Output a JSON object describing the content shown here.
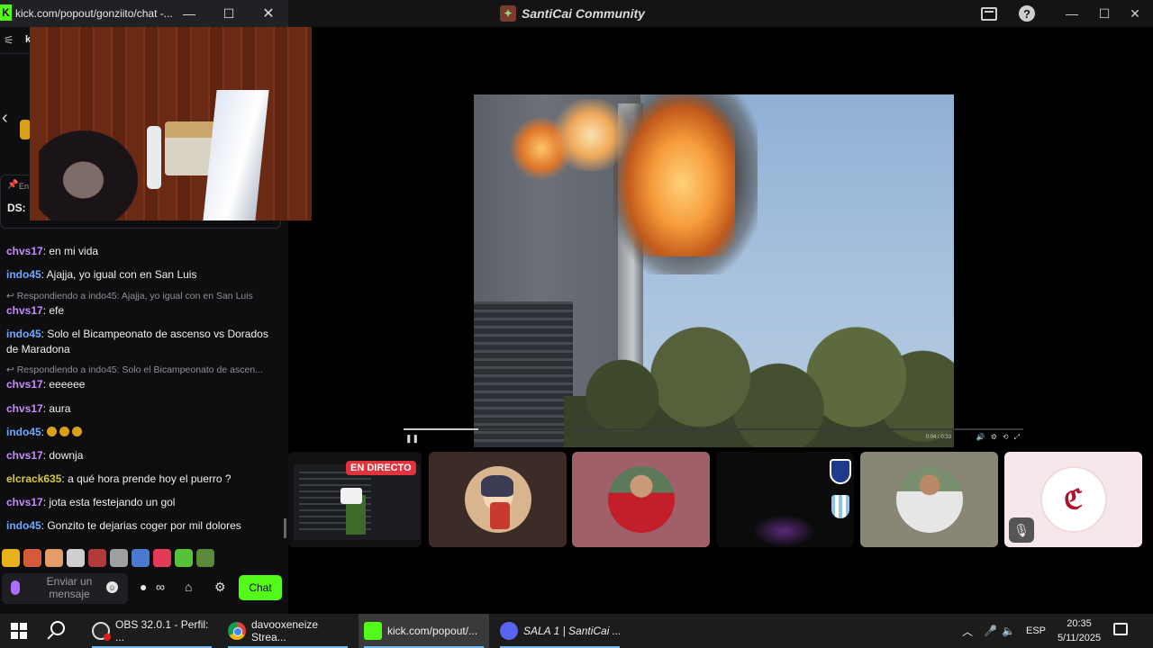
{
  "main_window": {
    "title": "SantiCai Community",
    "video": {
      "time": "0:04 / 0:33",
      "progress": 0.12
    },
    "tiles": {
      "live_badge": "EN DIRECTO",
      "logo_tile_text": "ℭ"
    }
  },
  "chat_window": {
    "url": "kick.com/popout/gonziito/chat -...",
    "header_k": "k",
    "pinned_label": "En",
    "pinned_ds": "DS:",
    "messages": [
      {
        "user": "chvs17",
        "text": ": en mi vida"
      },
      {
        "user": "indo45",
        "text": ": Ajajja, yo igual con en San Luis"
      },
      {
        "reply": "Respondiendo a indo45: Ajajja, yo igual con en San Luis"
      },
      {
        "user": "chvs17",
        "text": ": efe"
      },
      {
        "user": "indo45",
        "text": ": Solo el Bicampeonato de ascenso vs Dorados de Maradona"
      },
      {
        "reply": "Respondiendo a indo45: Solo el Bicampeonato de ascen..."
      },
      {
        "user": "chvs17",
        "text": ": eeeeee"
      },
      {
        "user": "chvs17",
        "text": ": aura"
      },
      {
        "user": "indo45",
        "text": ":"
      },
      {
        "user": "chvs17",
        "text": ": downja"
      },
      {
        "user": "elcrack635",
        "text": ": a qué hora prende hoy el puerro ?"
      },
      {
        "user": "chvs17",
        "text": ": jota esta festejando un gol"
      },
      {
        "user": "indo45",
        "text": ": Gonzito te dejarias coger por mil dolores"
      }
    ],
    "input_placeholder": "Enviar un mensaje",
    "chat_button": "Chat",
    "emote_colors": [
      "#e8b21a",
      "#d45a3a",
      "#e59b6a",
      "#cfcfcf",
      "#b33a3a",
      "#a0a0a0",
      "#4a7ad0",
      "#e33a5a",
      "#55c23a",
      "#5a8a3a"
    ]
  },
  "taskbar": {
    "items": [
      {
        "label": "OBS 32.0.1 - Perfil: ...",
        "icon": "obs-icon"
      },
      {
        "label": "davooxeneize Strea...",
        "icon": "chrome-icon"
      },
      {
        "label": "kick.com/popout/...",
        "icon": "kick-icon"
      },
      {
        "label": "SALA 1 | SantiCai ...",
        "icon": "discord-icon"
      }
    ],
    "language": "ESP",
    "time": "20:35",
    "date": "5/11/2025"
  }
}
